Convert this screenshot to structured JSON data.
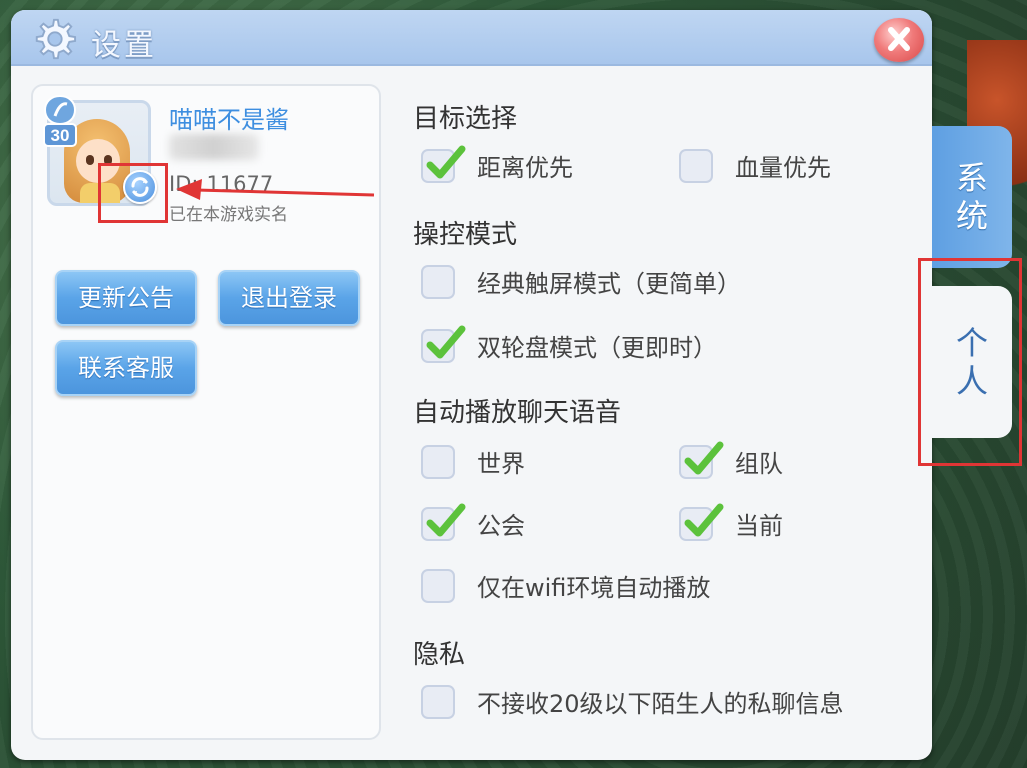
{
  "window": {
    "title": "设置",
    "close_icon": "close-icon"
  },
  "profile": {
    "player_name": "喵喵不是酱",
    "level": "30",
    "id_label": "ID:",
    "id_value": "11677",
    "realname_status": "已在本游戏实名"
  },
  "actions": {
    "update_notice": "更新公告",
    "logout": "退出登录",
    "contact_support": "联系客服"
  },
  "sections": {
    "target_select": {
      "title": "目标选择",
      "options": [
        {
          "label": "距离优先",
          "checked": true
        },
        {
          "label": "血量优先",
          "checked": false
        }
      ]
    },
    "control_mode": {
      "title": "操控模式",
      "options": [
        {
          "label": "经典触屏模式（更简单）",
          "checked": false
        },
        {
          "label": "双轮盘模式（更即时）",
          "checked": true
        }
      ]
    },
    "auto_voice": {
      "title": "自动播放聊天语音",
      "options": [
        {
          "label": "世界",
          "checked": false
        },
        {
          "label": "组队",
          "checked": true
        },
        {
          "label": "公会",
          "checked": true
        },
        {
          "label": "当前",
          "checked": true
        },
        {
          "label": "仅在wifi环境自动播放",
          "checked": false
        }
      ]
    },
    "privacy": {
      "title": "隐私",
      "options": [
        {
          "label": "不接收20级以下陌生人的私聊信息",
          "checked": false
        }
      ]
    }
  },
  "side_tabs": {
    "system": {
      "line1": "系",
      "line2": "统"
    },
    "personal": {
      "line1": "个",
      "line2": "人"
    }
  },
  "colors": {
    "accent": "#4c95dd",
    "name_blue": "#3d8ee0",
    "check_green": "#5cc23c",
    "annotation_red": "#e03535"
  }
}
